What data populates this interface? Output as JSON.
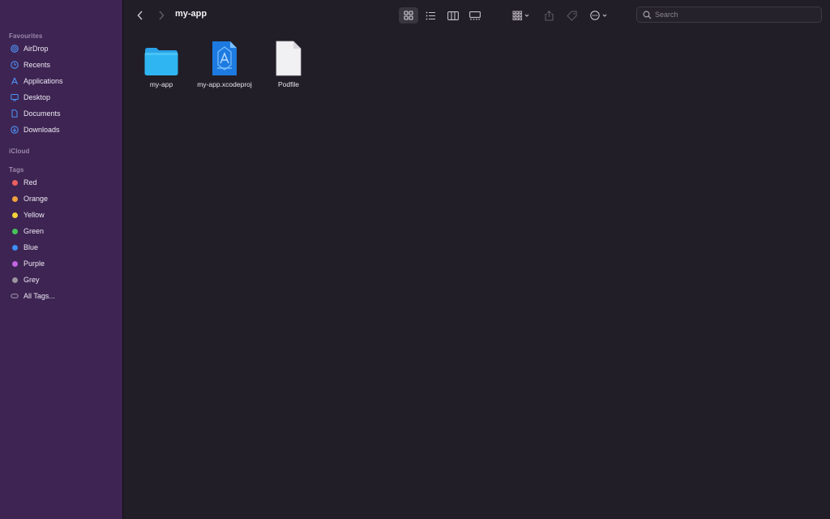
{
  "sidebar": {
    "favourites_label": "Favourites",
    "favourites": [
      {
        "label": "AirDrop",
        "icon": "airdrop-icon"
      },
      {
        "label": "Recents",
        "icon": "clock-icon"
      },
      {
        "label": "Applications",
        "icon": "applications-icon"
      },
      {
        "label": "Desktop",
        "icon": "desktop-icon"
      },
      {
        "label": "Documents",
        "icon": "document-icon"
      },
      {
        "label": "Downloads",
        "icon": "download-icon"
      }
    ],
    "icloud_label": "iCloud",
    "tags_label": "Tags",
    "tags": [
      {
        "label": "Red",
        "color": "#ec5f5f"
      },
      {
        "label": "Orange",
        "color": "#f0a23a"
      },
      {
        "label": "Yellow",
        "color": "#f3d23a"
      },
      {
        "label": "Green",
        "color": "#47c45a"
      },
      {
        "label": "Blue",
        "color": "#3d8ef7"
      },
      {
        "label": "Purple",
        "color": "#c263e0"
      },
      {
        "label": "Grey",
        "color": "#9a949e"
      }
    ],
    "all_tags_label": "All Tags..."
  },
  "toolbar": {
    "title": "my-app",
    "search_placeholder": "Search"
  },
  "files": [
    {
      "name": "my-app",
      "icon": "folder-icon"
    },
    {
      "name": "my-app.xcodeproj",
      "icon": "xcodeproj-icon"
    },
    {
      "name": "Podfile",
      "icon": "file-icon"
    }
  ],
  "colors": {
    "sidebar_bg": "#3d2452",
    "window_bg": "#221e27",
    "accent": "#3d8ef7"
  }
}
